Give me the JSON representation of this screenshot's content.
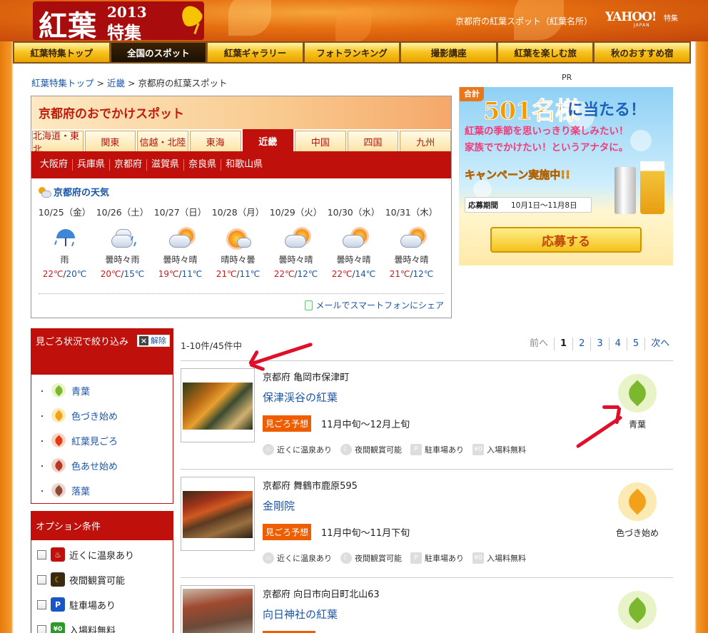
{
  "header": {
    "logo_main": "紅葉",
    "logo_year": "2013",
    "logo_sub": "特集",
    "subtitle": "京都府の紅葉スポット（紅葉名所）",
    "yahoo": "YAHOO!",
    "yahoo_japan": "JAPAN",
    "yahoo_tokushu": "特集"
  },
  "nav": [
    {
      "label": "紅葉特集トップ",
      "active": false
    },
    {
      "label": "全国のスポット",
      "active": true
    },
    {
      "label": "紅葉ギャラリー",
      "active": false
    },
    {
      "label": "フォトランキング",
      "active": false
    },
    {
      "label": "撮影講座",
      "active": false
    },
    {
      "label": "紅葉を楽しむ旅",
      "active": false
    },
    {
      "label": "秋のおすすめ宿",
      "active": false
    }
  ],
  "breadcrumb": {
    "items": [
      "紅葉特集トップ",
      "近畿"
    ],
    "separator": ">",
    "current": "京都府の紅葉スポット"
  },
  "spot": {
    "title": "京都府のおでかけスポット",
    "regions": [
      "北海道・東北",
      "関東",
      "信越・北陸",
      "東海",
      "近畿",
      "中国",
      "四国",
      "九州"
    ],
    "active_region": "近畿",
    "prefectures": [
      "大阪府",
      "兵庫県",
      "京都府",
      "滋賀県",
      "奈良県",
      "和歌山県"
    ]
  },
  "weather": {
    "title": "京都府の天気",
    "days": [
      {
        "date": "10/25（金）",
        "icon": "rain-umbrella-icon",
        "text": "雨",
        "high": "22℃",
        "low": "20℃"
      },
      {
        "date": "10/26（土）",
        "icon": "cloudy-rain-icon",
        "text": "曇時々雨",
        "high": "20℃",
        "low": "15℃"
      },
      {
        "date": "10/27（日）",
        "icon": "cloudy-sunny-icon",
        "text": "曇時々晴",
        "high": "19℃",
        "low": "11℃"
      },
      {
        "date": "10/28（月）",
        "icon": "sunny-cloudy-icon",
        "text": "晴時々曇",
        "high": "21℃",
        "low": "11℃"
      },
      {
        "date": "10/29（火）",
        "icon": "cloudy-sunny-icon",
        "text": "曇時々晴",
        "high": "22℃",
        "low": "12℃"
      },
      {
        "date": "10/30（水）",
        "icon": "cloudy-sunny-icon",
        "text": "曇時々晴",
        "high": "22℃",
        "low": "14℃"
      },
      {
        "date": "10/31（木）",
        "icon": "cloudy-sunny-icon",
        "text": "曇時々晴",
        "high": "21℃",
        "low": "12℃"
      }
    ],
    "temp_sep": "/",
    "share_link": "メールでスマートフォンにシェア"
  },
  "pr": {
    "label": "PR",
    "gokei": "合計",
    "count": "501名様",
    "count_tail": "に当たる！",
    "line1": "紅葉の季節を思いっきり楽しみたい！",
    "line2": "家族ででかけたい！というアナタに。",
    "campaign": "キャンペーン実施中!!",
    "period_label": "応募期間",
    "period_value": "10月1日～11月8日",
    "apply": "応募する"
  },
  "filter": {
    "title": "見ごろ状況で絞り込み",
    "clear": "解除",
    "items": [
      {
        "label": "青葉",
        "color": "#7cb82f"
      },
      {
        "label": "色づき始め",
        "color": "#f2a21a"
      },
      {
        "label": "紅葉見ごろ",
        "color": "#e23a12"
      },
      {
        "label": "色あせ始め",
        "color": "#b43a26"
      },
      {
        "label": "落葉",
        "color": "#8a4a36"
      }
    ]
  },
  "options": {
    "title": "オプション条件",
    "items": [
      {
        "label": "近くに温泉あり",
        "icon": "onsen-icon",
        "color": "#c0100b"
      },
      {
        "label": "夜間観賞可能",
        "icon": "moon-icon",
        "color": "#3a2a10"
      },
      {
        "label": "駐車場あり",
        "icon": "parking-icon",
        "color": "#1a55c6"
      },
      {
        "label": "入場料無料",
        "icon": "free-yen-icon",
        "color": "#2a9a2a"
      }
    ]
  },
  "results": {
    "count": "1-10件/45件中",
    "pager": {
      "prev": "前へ",
      "pages": [
        "1",
        "2",
        "3",
        "4",
        "5"
      ],
      "current": "1",
      "next": "次へ"
    },
    "tag_label": "見ごろ予想",
    "features": [
      "近くに温泉あり",
      "夜間観賞可能",
      "駐車場あり",
      "入場料無料"
    ],
    "items": [
      {
        "location": "京都府 亀岡市保津町",
        "name": "保津渓谷の紅葉",
        "period": "11月中旬～12月上旬",
        "status": "青葉",
        "status_color": "#7cb82f",
        "status_bg": "#e8f3c8"
      },
      {
        "location": "京都府 舞鶴市鹿原595",
        "name": "金剛院",
        "period": "11月中旬～11月下旬",
        "status": "色づき始め",
        "status_color": "#f2a21a",
        "status_bg": "#fbeab4"
      },
      {
        "location": "京都府 向日市向日町北山63",
        "name": "向日神社の紅葉",
        "period": "",
        "status": "",
        "status_color": "#7cb82f",
        "status_bg": "#e8f3c8"
      }
    ]
  },
  "colors": {
    "accent_red": "#c0100b",
    "link_blue": "#1a55a6",
    "tag_orange": "#ee5d00",
    "annotation_arrow": "#e0102a"
  }
}
